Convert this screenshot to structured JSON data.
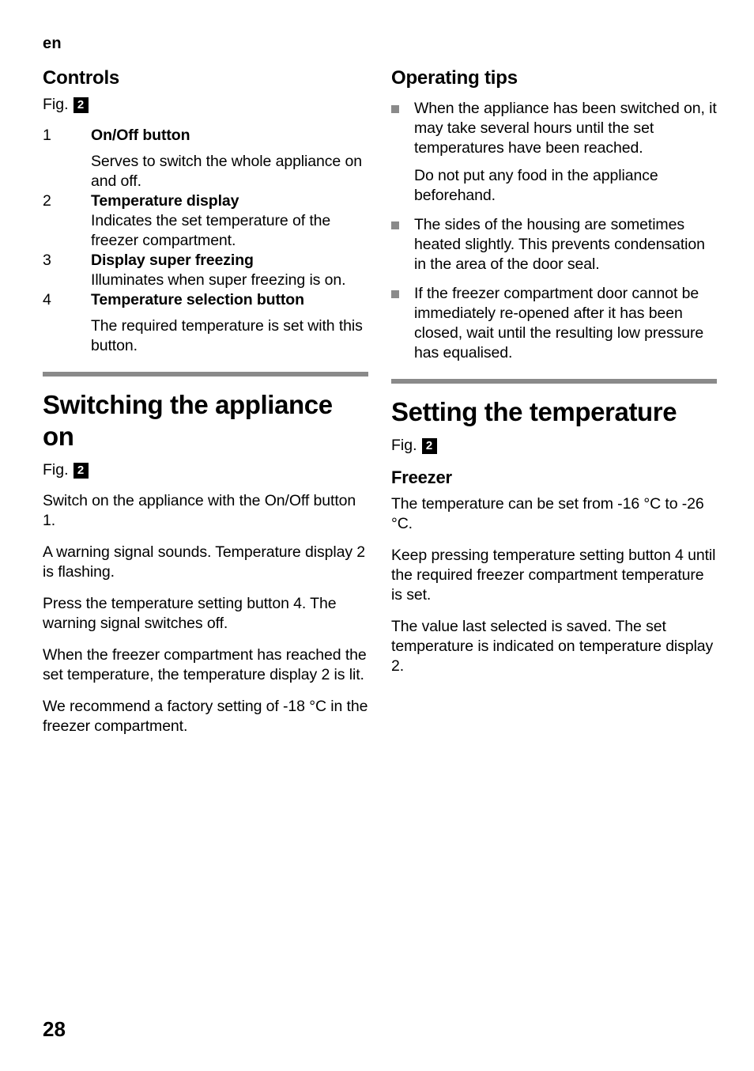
{
  "page": {
    "language_marker": "en",
    "page_number": "28",
    "rule_color": "#8a8a8a",
    "bullet_color": "#8a8a8a",
    "text_color": "#000000",
    "background_color": "#ffffff"
  },
  "left_column": {
    "controls": {
      "title": "Controls",
      "fig_label": "Fig.",
      "fig_number": "2",
      "items": [
        {
          "number": "1",
          "term": "On/Off button",
          "description": "Serves to switch the whole appliance on and off.",
          "spaced_description": true
        },
        {
          "number": "2",
          "term": "Temperature display",
          "description": "Indicates the set temperature of the freezer compartment.",
          "spaced_description": false
        },
        {
          "number": "3",
          "term": "Display super freezing",
          "description": "Illuminates when super freezing is on.",
          "spaced_description": false
        },
        {
          "number": "4",
          "term": "Temperature selection button",
          "description": "The required temperature is set with this button.",
          "spaced_description": true
        }
      ]
    },
    "switching_on": {
      "title": "Switching the appliance on",
      "fig_label": "Fig.",
      "fig_number": "2",
      "paragraphs": [
        "Switch on the appliance with the On/Off button 1.",
        "A warning signal sounds. Temperature display 2 is flashing.",
        "Press the temperature setting button 4. The warning signal switches off.",
        "When the freezer compartment has reached the set temperature, the temperature display 2 is lit.",
        "We recommend a factory setting of -18 °C in the freezer compartment."
      ]
    }
  },
  "right_column": {
    "operating_tips": {
      "title": "Operating tips",
      "tips": [
        {
          "paragraphs": [
            "When the appliance has been switched on, it may take several hours until the set temperatures have been reached.",
            "Do not put any food in the appliance beforehand."
          ]
        },
        {
          "paragraphs": [
            "The sides of the housing are sometimes heated slightly. This prevents condensation in the area of the door seal."
          ]
        },
        {
          "paragraphs": [
            "If the freezer compartment door cannot be immediately re-opened after it has been closed, wait until the resulting low pressure has equalised."
          ]
        }
      ]
    },
    "setting_temperature": {
      "title": "Setting the temperature",
      "fig_label": "Fig.",
      "fig_number": "2",
      "subhead": "Freezer",
      "paragraphs": [
        "The temperature can be set from -16 °C to -26 °C.",
        "Keep pressing temperature setting button 4 until the required freezer compartment temperature is set.",
        "The value last selected is saved. The set temperature is indicated on temperature display 2."
      ]
    }
  }
}
